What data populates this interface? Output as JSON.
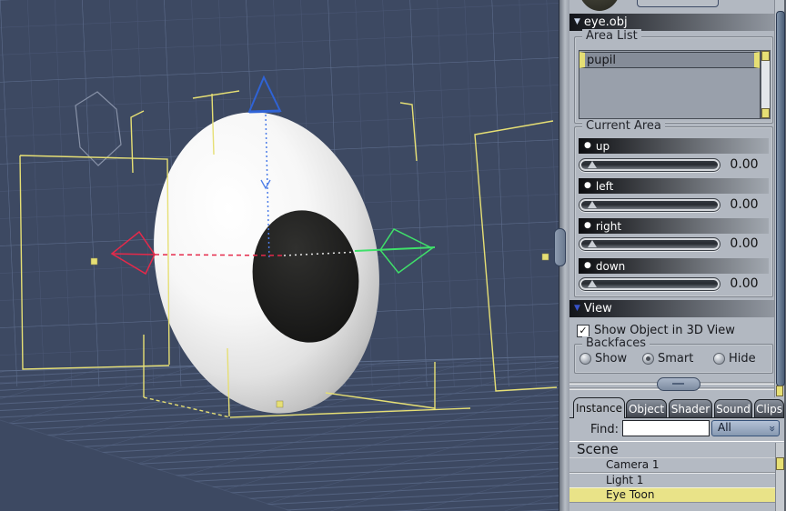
{
  "icons": {
    "collapse": "▼",
    "check": "✓",
    "bullet": "●",
    "dropdown_chevron": "»"
  },
  "viewport": {
    "bg_color": "#3d4962",
    "grid_color": "#4a5775",
    "grid_bright_color": "#5d6d8c",
    "wireframe_color": "#e6df74",
    "camera_wire_color": "#8892a8",
    "axis_x_color": "#e5294a",
    "axis_y_color": "#3fe06a",
    "axis_z_color": "#2f63d6",
    "model": "eyeball-with-pupil"
  },
  "panel": {
    "object_header": {
      "label": "eye.obj"
    },
    "area_list": {
      "group_label": "Area List",
      "items": [
        {
          "label": "pupil",
          "selected": true
        }
      ]
    },
    "current_area": {
      "group_label": "Current Area",
      "sliders": [
        {
          "label": "up",
          "value": "0.00"
        },
        {
          "label": "left",
          "value": "0.00"
        },
        {
          "label": "right",
          "value": "0.00"
        },
        {
          "label": "down",
          "value": "0.00"
        }
      ]
    },
    "view_header": {
      "label": "View"
    },
    "show_object": {
      "label": "Show Object in 3D View",
      "checked": true
    },
    "backfaces": {
      "group_label": "Backfaces",
      "options": [
        {
          "label": "Show",
          "selected": false
        },
        {
          "label": "Smart",
          "selected": true
        },
        {
          "label": "Hide",
          "selected": false
        }
      ]
    },
    "tabs": [
      {
        "label": "Instance",
        "active": true
      },
      {
        "label": "Object",
        "active": false
      },
      {
        "label": "Shader",
        "active": false
      },
      {
        "label": "Sound",
        "active": false
      },
      {
        "label": "Clips",
        "active": false
      }
    ],
    "find": {
      "label": "Find:",
      "value": "",
      "filter_value": "All"
    },
    "scene_tree": {
      "root": "Scene",
      "items": [
        {
          "label": "Camera 1",
          "highlighted": false
        },
        {
          "label": "Light 1",
          "highlighted": false
        },
        {
          "label": "Eye Toon",
          "highlighted": true
        }
      ]
    },
    "colors": {
      "panel_bg": "#b2b8c1",
      "highlight_row": "#e9e388"
    }
  }
}
